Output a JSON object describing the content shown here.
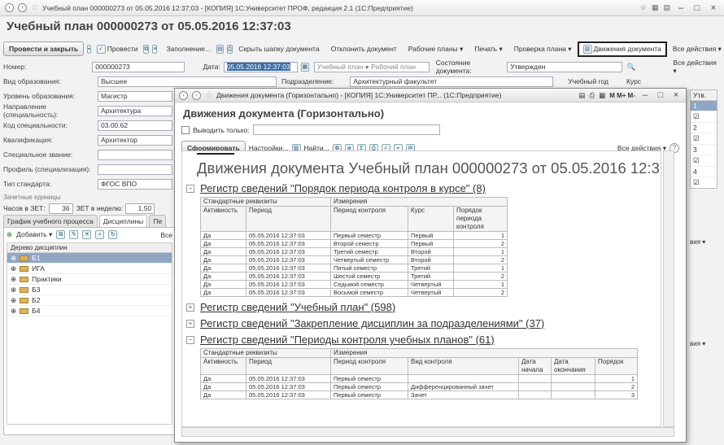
{
  "window": {
    "title": "Учебный план 000000273 от 05.05.2016 12:37:03 - [КОПИЯ] 1С:Университет ПРОФ, редакция 2.1 (1С:Предприятие)"
  },
  "document": {
    "heading": "Учебный план 000000273 от 05.05.2016 12:37:03"
  },
  "toolbar": {
    "post_close": "Провести и закрыть",
    "post": "Провести",
    "fill": "Заполнение...",
    "hide_header": "Скрыть шапку документа",
    "cancel_post": "Отклонить документ",
    "work_plans": "Рабочие планы ▾",
    "print": "Печать ▾",
    "check_plan": "Проверка плана ▾",
    "movements": "Движения документа",
    "all_actions": "Все действия ▾",
    "help": "?"
  },
  "form": {
    "number_label": "Номер:",
    "number": "000000273",
    "date_label": "Дата:",
    "date": "05.05.2016 12:37:03",
    "plan_type_1": "Учебный план",
    "plan_type_2": "Рабочий план",
    "doc_state_label": "Состояние документа:",
    "doc_state": "Утвержден",
    "all_actions_2": "Все действия ▾",
    "edu_kind_label": "Вид образования:",
    "edu_kind": "Высшее",
    "division_label": "Подразделение:",
    "division": "Архитектурный факультет",
    "study_year": "Учебный год",
    "course": "Курс",
    "level_label": "Уровень образования:",
    "level": "Магистр",
    "direction_label": "Направление (специальность):",
    "direction": "Архитектура",
    "spec_code_label": "Код специальности:",
    "spec_code": "03.00.62",
    "qualification_label": "Квалификация:",
    "qualification": "Архитектор",
    "special_title_label": "Специальное звание:",
    "special_title": "",
    "profile_label": "Профиль (специализация):",
    "profile": "",
    "standard_label": "Тип стандарта:",
    "standard": "ФГОС ВПО",
    "credits_label": "Зачетные единицы",
    "hours_label": "Часов в ЗЕТ:",
    "hours": "36",
    "zet_week_label": "ЗЕТ в неделю:",
    "zet_week": "1,50"
  },
  "right_panel": {
    "header": "Утв.",
    "rows": [
      "1",
      "2",
      "3",
      "4"
    ],
    "all_label": "вия ▾",
    "all_label_2": "вия ▾"
  },
  "left_panel": {
    "tabs": [
      "График учебного процесса",
      "Дисциплины",
      "Пе"
    ],
    "add": "Добавить ▾",
    "all": "Все",
    "tree_header": "Дерево дисциплин",
    "tree_items": [
      "Б1",
      "ИГА",
      "Практики",
      "Б3",
      "Б2",
      "Б4"
    ]
  },
  "popup": {
    "title": "Движения документа (Горизонтально) - [КОПИЯ] 1С:Университет ПР... (1С:Предприятие)",
    "heading": "Движения документа (Горизонтально)",
    "only_label": "Выводить только:",
    "generate": "Сформировать",
    "settings": "Настройки...",
    "find": "Найти...",
    "all_actions": "Все действия ▾",
    "report_title": "Движения документа Учебный план 000000273 от 05.05.2016 12:37:03",
    "reg1": {
      "title": "Регистр сведений \"Порядок периода контроля в курсе\" (8)",
      "group1": "Стандартные реквизиты",
      "group2": "Измерения",
      "cols": [
        "Активность",
        "Период",
        "Период контроля",
        "Курс",
        "Порядок периода контроля"
      ],
      "rows": [
        [
          "Да",
          "05.05.2016 12:37:03",
          "Первый семестр",
          "Первый",
          "1"
        ],
        [
          "Да",
          "05.05.2016 12:37:03",
          "Второй семестр",
          "Первый",
          "2"
        ],
        [
          "Да",
          "05.05.2016 12:37:03",
          "Третий семестр",
          "Второй",
          "1"
        ],
        [
          "Да",
          "05.05.2016 12:37:03",
          "Четвертый семестр",
          "Второй",
          "2"
        ],
        [
          "Да",
          "05.05.2016 12:37:03",
          "Пятый семестр",
          "Третий",
          "1"
        ],
        [
          "Да",
          "05.05.2016 12:37:03",
          "Шестой семестр",
          "Третий",
          "2"
        ],
        [
          "Да",
          "05.05.2016 12:37:03",
          "Седьмой семестр",
          "Четвертый",
          "1"
        ],
        [
          "Да",
          "05.05.2016 12:37:03",
          "Восьмой семестр",
          "Четвертый",
          "2"
        ]
      ]
    },
    "reg2": {
      "title": "Регистр сведений \"Учебный план\" (598)"
    },
    "reg3": {
      "title": "Регистр сведений \"Закрепление дисциплин за подразделениями\" (37)"
    },
    "reg4": {
      "title": "Регистр сведений \"Периоды контроля учебных планов\" (61)",
      "group1": "Стандартные реквизиты",
      "group2": "Измерения",
      "cols": [
        "Активность",
        "Период",
        "Период контроля",
        "Вид контроля",
        "Дата начала",
        "Дата окончания",
        "Порядок"
      ],
      "rows": [
        [
          "Да",
          "05.05.2016 12:37:03",
          "Первый семестр",
          "",
          "",
          "",
          "1"
        ],
        [
          "Да",
          "05.05.2016 12:37:03",
          "Первый семестр",
          "Дифференцированный зачет",
          "",
          "",
          "2"
        ],
        [
          "Да",
          "05.05.2016 12:37:03",
          "Первый семестр",
          "Зачет",
          "",
          "",
          "3"
        ]
      ]
    }
  }
}
